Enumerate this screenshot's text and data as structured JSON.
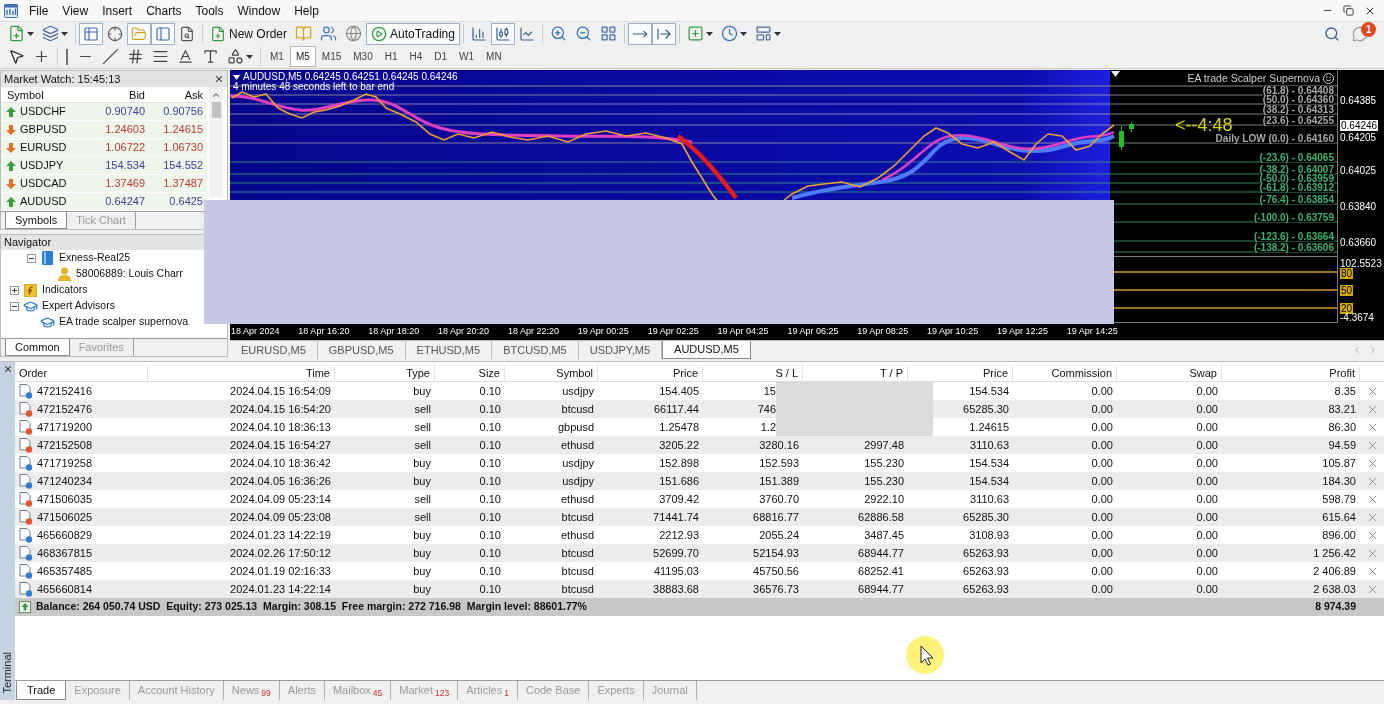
{
  "window": {
    "menu": [
      "File",
      "View",
      "Insert",
      "Charts",
      "Tools",
      "Window",
      "Help"
    ],
    "notifications": "1"
  },
  "toolbar": {
    "view_toggles": [
      {
        "kind": "market_watch",
        "on": true
      },
      {
        "kind": "data_window",
        "on": false
      },
      {
        "kind": "navigator",
        "on": true
      },
      {
        "kind": "terminal",
        "on": true
      },
      {
        "kind": "tester",
        "on": false
      }
    ],
    "new_order": "New Order",
    "autotrading": {
      "label": "AutoTrading",
      "on": true
    },
    "chart_types": [
      {
        "kind": "bars",
        "selected": false
      },
      {
        "kind": "candles",
        "selected": true
      },
      {
        "kind": "line",
        "selected": false
      }
    ],
    "scroll_toggles": [
      {
        "kind": "shift",
        "on": true
      },
      {
        "kind": "autoscroll",
        "on": true
      }
    ],
    "timeframes": [
      {
        "label": "M1",
        "selected": false
      },
      {
        "label": "M5",
        "selected": true
      },
      {
        "label": "M15",
        "selected": false
      },
      {
        "label": "M30",
        "selected": false
      },
      {
        "label": "H1",
        "selected": false
      },
      {
        "label": "H4",
        "selected": false
      },
      {
        "label": "D1",
        "selected": false
      },
      {
        "label": "W1",
        "selected": false
      },
      {
        "label": "MN",
        "selected": false
      }
    ]
  },
  "market_watch": {
    "title": "Market Watch: 15:45:13",
    "columns": [
      "Symbol",
      "Bid",
      "Ask"
    ],
    "rows": [
      {
        "symbol": "USDCHF",
        "bid": "0.90740",
        "ask": "0.90756",
        "kind": "up"
      },
      {
        "symbol": "GBPUSD",
        "bid": "1.24603",
        "ask": "1.24615",
        "kind": "down"
      },
      {
        "symbol": "EURUSD",
        "bid": "1.06722",
        "ask": "1.06730",
        "kind": "down"
      },
      {
        "symbol": "USDJPY",
        "bid": "154.534",
        "ask": "154.552",
        "kind": "up"
      },
      {
        "symbol": "USDCAD",
        "bid": "1.37469",
        "ask": "1.37487",
        "kind": "down"
      },
      {
        "symbol": "AUDUSD",
        "bid": "0.64247",
        "ask": "0.6425",
        "kind": "up"
      }
    ],
    "tabs": [
      {
        "label": "Symbols",
        "selected": true
      },
      {
        "label": "Tick Chart",
        "selected": false
      }
    ]
  },
  "navigator": {
    "title": "Navigator",
    "tree": [
      {
        "children": [
          {
            "kind": "server",
            "label": "Exness-Real25",
            "expanded": true,
            "children": [
              {
                "kind": "account",
                "label": "58006889: Louis Charr"
              }
            ]
          }
        ]
      },
      {
        "kind": "indicators",
        "label": "Indicators",
        "expanded": false
      },
      {
        "kind": "experts",
        "label": "Expert Advisors",
        "expanded": true,
        "children": [
          {
            "kind": "expert",
            "label": "EA trade scalper supernova"
          }
        ]
      }
    ],
    "tabs": [
      {
        "label": "Common",
        "selected": true
      },
      {
        "label": "Favorites",
        "selected": false
      }
    ]
  },
  "chart": {
    "header": "AUDUSD,M5 0.64245 0.64251 0.64245 0.64246",
    "timer_note": "4 minutes 48 seconds left to bar end",
    "expert": "EA trade Scalper Supernova",
    "countdown": "<--4:48",
    "fib_levels": [
      {
        "label": "(61.8) - 0.64408",
        "color": "#a8a8a8"
      },
      {
        "label": "(50.0) - 0.64360",
        "color": "#a8a8a8"
      },
      {
        "label": "(38.2) - 0.64313",
        "color": "#a8a8a8"
      },
      {
        "label": "(23.6) - 0.64255",
        "color": "#a8a8a8"
      },
      {
        "label": "Daily LOW (0.0) - 0.64160",
        "color": "#a8a8a8"
      },
      {
        "label": "(-23.6) - 0.64065",
        "color": "#3cb371"
      },
      {
        "label": "(-38.2) - 0.64007",
        "color": "#3cb371"
      },
      {
        "label": "(-50.0) - 0.63959",
        "color": "#3cb371"
      },
      {
        "label": "(-61.8) - 0.63912",
        "color": "#3cb371"
      },
      {
        "label": "(-76.4) - 0.63854",
        "color": "#3cb371"
      },
      {
        "label": "(-100.0) - 0.63759",
        "color": "#3cb371"
      },
      {
        "label": "(-123.6) - 0.63664",
        "color": "#3cb371"
      },
      {
        "label": "(-138.2) - 0.63606",
        "color": "#3cb371"
      }
    ],
    "price_axis": [
      {
        "label": "0.64385",
        "kind": "tick"
      },
      {
        "label": "0.64246",
        "kind": "current"
      },
      {
        "label": "0.64205",
        "kind": "tick"
      },
      {
        "label": "0.64025",
        "kind": "tick"
      },
      {
        "label": "0.63840",
        "kind": "tick"
      },
      {
        "label": "0.63660",
        "kind": "tick"
      }
    ],
    "indicator_axis": [
      {
        "label": "102.5523",
        "kind": "tick"
      },
      {
        "label": "80",
        "kind": "level"
      },
      {
        "label": "50",
        "kind": "level"
      },
      {
        "label": "20",
        "kind": "level"
      },
      {
        "label": "-4.3674",
        "kind": "tick"
      }
    ],
    "time_axis": [
      "18 Apr 2024",
      "18 Apr 16:20",
      "18 Apr 18:20",
      "18 Apr 20:20",
      "18 Apr 22:20",
      "19 Apr 00:25",
      "19 Apr 02:25",
      "19 Apr 04:25",
      "19 Apr 06:25",
      "19 Apr 08:25",
      "19 Apr 10:25",
      "19 Apr 12:25",
      "19 Apr 14:25"
    ]
  },
  "chart_tabs": [
    {
      "label": "EURUSD,M5",
      "selected": false
    },
    {
      "label": "GBPUSD,M5",
      "selected": false
    },
    {
      "label": "ETHUSD,M5",
      "selected": false
    },
    {
      "label": "BTCUSD,M5",
      "selected": false
    },
    {
      "label": "USDJPY,M5",
      "selected": false
    },
    {
      "label": "AUDUSD,M5",
      "selected": true
    }
  ],
  "terminal": {
    "title": "Terminal",
    "columns": [
      "Order",
      "Time",
      "Type",
      "Size",
      "Symbol",
      "Price",
      "S / L",
      "T / P",
      "Price",
      "Commission",
      "Swap",
      "Profit"
    ],
    "rows": [
      {
        "kind": "buy",
        "covered": true,
        "order": "472152416",
        "time": "2024.04.15 16:54:09",
        "type": "buy",
        "size": "0.10",
        "symbol": "usdjpy",
        "price": "154.405",
        "sl": "15",
        "price_now": "154.534",
        "commission": "0.00",
        "swap": "0.00",
        "profit": "8.35"
      },
      {
        "kind": "sell",
        "covered": true,
        "order": "472152476",
        "time": "2024.04.15 16:54:20",
        "type": "sell",
        "size": "0.10",
        "symbol": "btcusd",
        "price": "66117.44",
        "sl": "746",
        "price_now": "65285.30",
        "commission": "0.00",
        "swap": "0.00",
        "profit": "83.21"
      },
      {
        "kind": "sell",
        "covered": true,
        "order": "471719200",
        "time": "2024.04.10 18:36:13",
        "type": "sell",
        "size": "0.10",
        "symbol": "gbpusd",
        "price": "1.25478",
        "sl": "1.2",
        "price_now": "1.24615",
        "commission": "0.00",
        "swap": "0.00",
        "profit": "86.30"
      },
      {
        "kind": "sell",
        "covered": false,
        "order": "472152508",
        "time": "2024.04.15 16:54:27",
        "type": "sell",
        "size": "0.10",
        "symbol": "ethusd",
        "price": "3205.22",
        "sl": "3280.16",
        "tp": "2997.48",
        "price_now": "3110.63",
        "commission": "0.00",
        "swap": "0.00",
        "profit": "94.59"
      },
      {
        "kind": "buy",
        "covered": false,
        "order": "471719258",
        "time": "2024.04.10 18:36:42",
        "type": "buy",
        "size": "0.10",
        "symbol": "usdjpy",
        "price": "152.898",
        "sl": "152.593",
        "tp": "155.230",
        "price_now": "154.534",
        "commission": "0.00",
        "swap": "0.00",
        "profit": "105.87"
      },
      {
        "kind": "buy",
        "covered": false,
        "order": "471240234",
        "time": "2024.04.05 16:36:26",
        "type": "buy",
        "size": "0.10",
        "symbol": "usdjpy",
        "price": "151.686",
        "sl": "151.389",
        "tp": "155.230",
        "price_now": "154.534",
        "commission": "0.00",
        "swap": "0.00",
        "profit": "184.30"
      },
      {
        "kind": "sell",
        "covered": false,
        "order": "471506035",
        "time": "2024.04.09 05:23:14",
        "type": "sell",
        "size": "0.10",
        "symbol": "ethusd",
        "price": "3709.42",
        "sl": "3760.70",
        "tp": "2922.10",
        "price_now": "3110.63",
        "commission": "0.00",
        "swap": "0.00",
        "profit": "598.79"
      },
      {
        "kind": "sell",
        "covered": false,
        "order": "471506025",
        "time": "2024.04.09 05:23:08",
        "type": "sell",
        "size": "0.10",
        "symbol": "btcusd",
        "price": "71441.74",
        "sl": "68816.77",
        "tp": "62886.58",
        "price_now": "65285.30",
        "commission": "0.00",
        "swap": "0.00",
        "profit": "615.64"
      },
      {
        "kind": "buy",
        "covered": false,
        "order": "465660829",
        "time": "2024.01.23 14:22:19",
        "type": "buy",
        "size": "0.10",
        "symbol": "ethusd",
        "price": "2212.93",
        "sl": "2055.24",
        "tp": "3487.45",
        "price_now": "3108.93",
        "commission": "0.00",
        "swap": "0.00",
        "profit": "896.00"
      },
      {
        "kind": "buy",
        "covered": false,
        "order": "468367815",
        "time": "2024.02.26 17:50:12",
        "type": "buy",
        "size": "0.10",
        "symbol": "btcusd",
        "price": "52699.70",
        "sl": "52154.93",
        "tp": "68944.77",
        "price_now": "65263.93",
        "commission": "0.00",
        "swap": "0.00",
        "profit": "1 256.42"
      },
      {
        "kind": "buy",
        "covered": false,
        "order": "465357485",
        "time": "2024.01.19 02:16:33",
        "type": "buy",
        "size": "0.10",
        "symbol": "btcusd",
        "price": "41195.03",
        "sl": "45750.56",
        "tp": "68252.41",
        "price_now": "65263.93",
        "commission": "0.00",
        "swap": "0.00",
        "profit": "2 406.89"
      },
      {
        "kind": "buy",
        "covered": false,
        "order": "465660814",
        "time": "2024.01.23 14:22:14",
        "type": "buy",
        "size": "0.10",
        "symbol": "btcusd",
        "price": "38883.68",
        "sl": "36576.73",
        "tp": "68944.77",
        "price_now": "65263.93",
        "commission": "0.00",
        "swap": "0.00",
        "profit": "2 638.03"
      }
    ],
    "summary": {
      "text": "Balance: 264 050.74 USD  Equity: 273 025.13  Margin: 308.15  Free margin: 272 716.98  Margin level: 88601.77%",
      "profit": "8 974.39"
    },
    "tabs": [
      {
        "label": "Trade",
        "selected": true
      },
      {
        "label": "Exposure",
        "selected": false
      },
      {
        "label": "Account History",
        "selected": false
      },
      {
        "label": "News",
        "count": "99",
        "selected": false
      },
      {
        "label": "Alerts",
        "selected": false
      },
      {
        "label": "Mailbox",
        "count": "45",
        "selected": false
      },
      {
        "label": "Market",
        "count": "123",
        "selected": false
      },
      {
        "label": "Articles",
        "count": "1",
        "selected": false
      },
      {
        "label": "Code Base",
        "selected": false
      },
      {
        "label": "Experts",
        "selected": false
      },
      {
        "label": "Journal",
        "selected": false
      }
    ]
  }
}
